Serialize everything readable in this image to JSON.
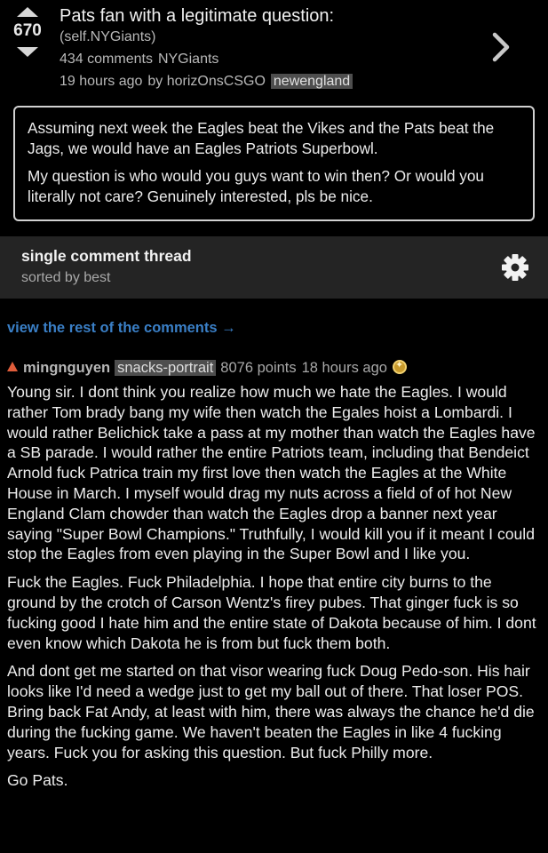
{
  "post": {
    "score": "670",
    "title": "Pats fan with a legitimate question:",
    "subreddit_tag": "(self.NYGiants)",
    "comments": "434 comments",
    "subreddit": "NYGiants",
    "time": "19 hours ago",
    "by": "by horizOnsCSGO",
    "flair": "newengland",
    "selftext": [
      "Assuming next week the Eagles beat the Vikes and the Pats beat the Jags, we would have an Eagles Patriots Superbowl.",
      "My question is who would you guys want to win then? Or would you literally not care? Genuinely interested, pls be nice."
    ]
  },
  "thread": {
    "title": "single comment thread",
    "sort": "sorted by best",
    "view_rest": "view the rest of the comments →"
  },
  "comment": {
    "author": "mingnguyen",
    "flair": "snacks-portrait",
    "points": "8076 points",
    "time": "18 hours ago",
    "paragraphs": [
      "Young sir. I dont think you realize how much we hate the Eagles. I would rather Tom brady bang my wife then watch the Egales hoist a Lombardi. I would rather Belichick take a pass at my mother than watch the Eagles have a SB parade. I would rather the entire Patriots team, including that Bendeict Arnold fuck Patrica train my first love then watch the Eagles at the White House in March. I myself would drag my nuts across a field of of hot New England Clam chowder than watch the Eagles drop a banner next year saying \"Super Bowl Champions.\" Truthfully, I would kill you if it meant I could stop the Eagles from even playing in the Super Bowl and I like you.",
      "Fuck the Eagles. Fuck Philadelphia. I hope that entire city burns to the ground by the crotch of Carson Wentz's firey pubes. That ginger fuck is so fucking good I hate him and the entire state of Dakota because of him. I dont even know which Dakota he is from but fuck them both.",
      "And dont get me started on that visor wearing fuck Doug Pedo-son. His hair looks like I'd need a wedge just to get my ball out of there. That loser POS. Bring back Fat Andy, at least with him, there was always the chance he'd die during the fucking game. We haven't beaten the Eagles in like 4 fucking years. Fuck you for asking this question. But fuck Philly more.",
      "Go Pats."
    ]
  },
  "icons": {
    "upvote": "upvote-arrow-icon",
    "downvote": "downvote-arrow-icon",
    "open": "chevron-right-icon",
    "settings": "gear-icon",
    "gilded": "gold-award-icon"
  },
  "colors": {
    "background": "#000000",
    "thread_bar": "#242424",
    "link": "#3a7fc6",
    "upvoted": "#e05d3b",
    "flair_bg": "#4e4e4e"
  }
}
